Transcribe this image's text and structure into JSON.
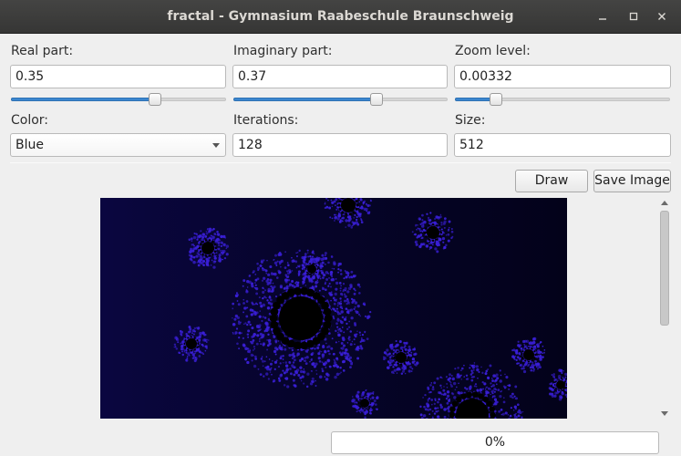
{
  "window": {
    "title": "fractal - Gymnasium Raabeschule Braunschweig"
  },
  "controls": {
    "real": {
      "label": "Real part:",
      "value": "0.35",
      "slider_fraction": 0.67
    },
    "imag": {
      "label": "Imaginary part:",
      "value": "0.37",
      "slider_fraction": 0.67
    },
    "zoom": {
      "label": "Zoom level:",
      "value": "0.00332",
      "slider_fraction": 0.19
    },
    "color": {
      "label": "Color:",
      "value": "Blue"
    },
    "iterations": {
      "label": "Iterations:",
      "value": "128"
    },
    "size": {
      "label": "Size:",
      "value": "512"
    }
  },
  "buttons": {
    "draw": "Draw",
    "save": "Save Image"
  },
  "progress": {
    "text": "0%",
    "fraction": 0
  },
  "colors": {
    "fractal_glow": "#3a1fd8",
    "fractal_bg": "#050320",
    "accent": "#3b86cf"
  }
}
